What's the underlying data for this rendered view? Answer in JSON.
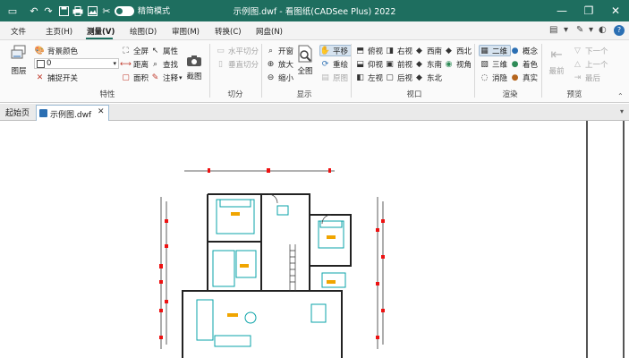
{
  "app": {
    "window_title": "示例图.dwf - 看图纸(CADSee Plus) 2022",
    "mode_label": "精简模式",
    "colors": {
      "titlebar": "#1e6e5f",
      "accent": "#1e6e5f",
      "selection": "#d6e3ef"
    }
  },
  "quick_access": [
    {
      "name": "folder-icon",
      "glyph": "▭"
    },
    {
      "name": "undo-icon",
      "glyph": "↶"
    },
    {
      "name": "redo-icon",
      "glyph": "↷"
    },
    {
      "name": "save-icon",
      "glyph": "▣"
    },
    {
      "name": "print-icon",
      "glyph": "⎙"
    },
    {
      "name": "image-icon",
      "glyph": "▨"
    }
  ],
  "menu": {
    "items": [
      "文件",
      "主页(H)",
      "测量(V)",
      "绘图(D)",
      "审图(M)",
      "转换(C)",
      "网盘(N)"
    ],
    "active_index": 2
  },
  "ribbon": {
    "groups": {
      "properties": {
        "label": "特性",
        "layers": "图层",
        "bg_color": "背景颜色",
        "layer_value": "0",
        "snap": "捕捉开关",
        "fullscreen": "全屏",
        "distance": "距离",
        "area": "面积",
        "attributes": "属性",
        "find": "查找",
        "annotate": "注释",
        "screenshot": "截图"
      },
      "split": {
        "label": "切分",
        "horizontal": "水平切分",
        "vertical": "垂直切分"
      },
      "display": {
        "label": "显示",
        "open": "开窗",
        "zoom_in": "放大",
        "zoom_out": "缩小",
        "full_view": "全图",
        "pan": "平移",
        "regen": "重绘",
        "original": "原图"
      },
      "viewport": {
        "label": "视口",
        "top": "俯视",
        "right": "右视",
        "southwest": "西南",
        "northwest": "西北",
        "bottom": "仰视",
        "front": "前视",
        "southeast": "东南",
        "view": "视角",
        "left": "左视",
        "back": "后视",
        "northeast": "东北"
      },
      "render": {
        "label": "渲染",
        "2d": "二维",
        "concept": "概念",
        "3d": "三维",
        "shade": "着色",
        "hidden": "消隐",
        "realistic": "真实"
      },
      "preview": {
        "label": "预览",
        "first": "最前",
        "next": "下一个",
        "prev": "上一个",
        "last": "最后"
      }
    }
  },
  "tabs": {
    "start": "起始页",
    "document": "示例图.dwf"
  }
}
